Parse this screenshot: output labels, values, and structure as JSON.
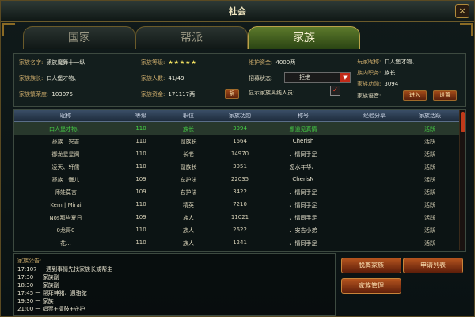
{
  "window": {
    "title": "社会",
    "close": "×"
  },
  "tabs": [
    {
      "label": "国家",
      "active": false
    },
    {
      "label": "帮派",
      "active": false
    },
    {
      "label": "家族",
      "active": true
    }
  ],
  "info": {
    "name_label": "家族名字:",
    "name_value": "孫族魔舞十一纵",
    "leader_label": "家族族长:",
    "leader_value": "口人堡才物、",
    "prosperity_label": "家族繁荣度:",
    "prosperity_value": "103075",
    "level_label": "家族等级:",
    "level_value": "★★★★★",
    "members_label": "家族人数:",
    "members_value": "41/49",
    "funds_label": "家族资金:",
    "funds_value": "171117两",
    "donate_label": "捐",
    "upkeep_label": "维护资金:",
    "upkeep_value": "4000两",
    "recruit_label": "招募状态:",
    "recruit_value": "拒绝",
    "show_all_label": "显示家族离线人员:",
    "show_all_checked": "✓"
  },
  "player": {
    "name_label": "玩家昵称:",
    "name_value": "口人堡才物、",
    "post_label": "族内职务:",
    "post_value": "族长",
    "merit_label": "家族功勋:",
    "merit_value": "3094",
    "voice_label": "家族语音:",
    "enter_button": "进入",
    "settings_button": "设置"
  },
  "table": {
    "columns": [
      "昵称",
      "等级",
      "职位",
      "家族功勋",
      "称号",
      "经验分享",
      "家族活跃"
    ],
    "rows": [
      {
        "name": "口人堡才物、",
        "level": "110",
        "post": "族长",
        "merit": "3094",
        "title": "霸道见真情",
        "share": "",
        "active": "活跃",
        "highlight": true
      },
      {
        "name": "孫族...安吉",
        "level": "110",
        "post": "副族长",
        "merit": "1664",
        "title": "Cherish",
        "share": "",
        "active": "活跃",
        "highlight": false
      },
      {
        "name": "御龙星星阁",
        "level": "110",
        "post": "长老",
        "merit": "14970",
        "title": "、情同手足",
        "share": "",
        "active": "活跃",
        "highlight": false
      },
      {
        "name": "凌天、轩儒",
        "level": "110",
        "post": "副族长",
        "merit": "3051",
        "title": "您水年华、",
        "share": "",
        "active": "活跃",
        "highlight": false
      },
      {
        "name": "孫族...慢儿",
        "level": "109",
        "post": "左护法",
        "merit": "22035",
        "title": "CherisN",
        "share": "",
        "active": "活跃",
        "highlight": false
      },
      {
        "name": "师娃莫言",
        "level": "109",
        "post": "右护法",
        "merit": "3422",
        "title": "、情同手足",
        "share": "",
        "active": "活跃",
        "highlight": false
      },
      {
        "name": "Kem丨Mirai",
        "level": "110",
        "post": "精英",
        "merit": "7210",
        "title": "、情同手足",
        "share": "",
        "active": "活跃",
        "highlight": false
      },
      {
        "name": "Nos那些夏日",
        "level": "109",
        "post": "族人",
        "merit": "11021",
        "title": "、情同手足",
        "share": "",
        "active": "活跃",
        "highlight": false
      },
      {
        "name": "0龙哥0",
        "level": "110",
        "post": "族人",
        "merit": "2622",
        "title": "、安吉小弟",
        "share": "",
        "active": "活跃",
        "highlight": false
      },
      {
        "name": "花...",
        "level": "110",
        "post": "族人",
        "merit": "1241",
        "title": "、情同手足",
        "share": "",
        "active": "活跃",
        "highlight": false
      }
    ]
  },
  "chat": {
    "header": "家族公告:",
    "lines": [
      "17:107 一 遇到事情先找家族长或帮主",
      "17:30 一 家族副",
      "18:30 一 家族副",
      "17:45 一 帮拜神猪、遇骆驼",
      "19:30 一 家族",
      "21:00 一 唱票+擂鼓+守护"
    ]
  },
  "buttons": {
    "leave": "脱离家族",
    "apply": "申请列表",
    "manage": "家族管理"
  }
}
